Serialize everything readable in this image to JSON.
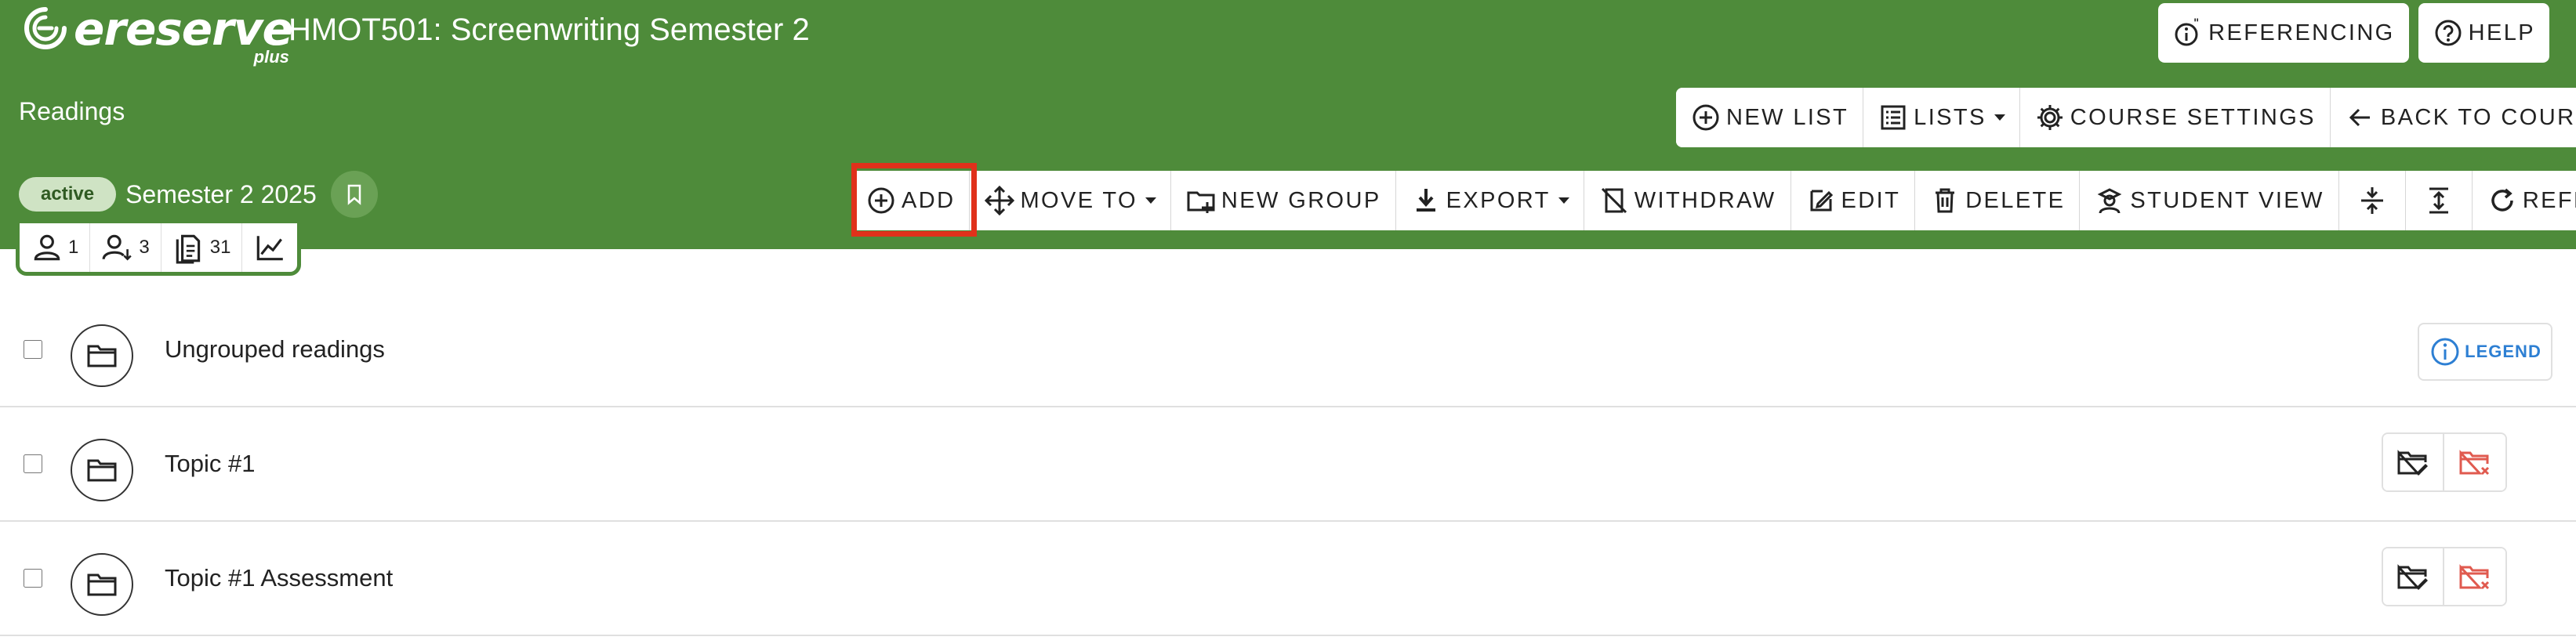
{
  "brand": {
    "name": "ereserve",
    "sub": "plus"
  },
  "course": {
    "title": "HMOT501: Screenwriting Semester 2"
  },
  "header": {
    "readings_label": "Readings",
    "referencing_label": "REFERENCING",
    "help_label": "HELP"
  },
  "list_toolbar": {
    "new_list": "NEW LIST",
    "lists": "LISTS",
    "course_settings": "COURSE SETTINGS",
    "back_to_course": "BACK TO COURSE"
  },
  "toolbar": {
    "add": "ADD",
    "move_to": "MOVE TO",
    "new_group": "NEW GROUP",
    "export": "EXPORT",
    "withdraw": "WITHDRAW",
    "edit": "EDIT",
    "delete": "DELETE",
    "student_view": "STUDENT VIEW",
    "refresh": "REFRESH"
  },
  "status": {
    "badge": "active",
    "semester": "Semester 2 2025"
  },
  "stats": {
    "users": "1",
    "user_requests": "3",
    "documents": "31"
  },
  "groups": [
    {
      "title": "Ungrouped readings"
    },
    {
      "title": "Topic #1"
    },
    {
      "title": "Topic #1 Assessment"
    }
  ],
  "legend_label": "LEGEND",
  "colors": {
    "header_green": "#4e8b3a",
    "highlight_red": "#e0311b",
    "legend_blue": "#2d7fd3",
    "delete_red": "#e05a4f"
  }
}
